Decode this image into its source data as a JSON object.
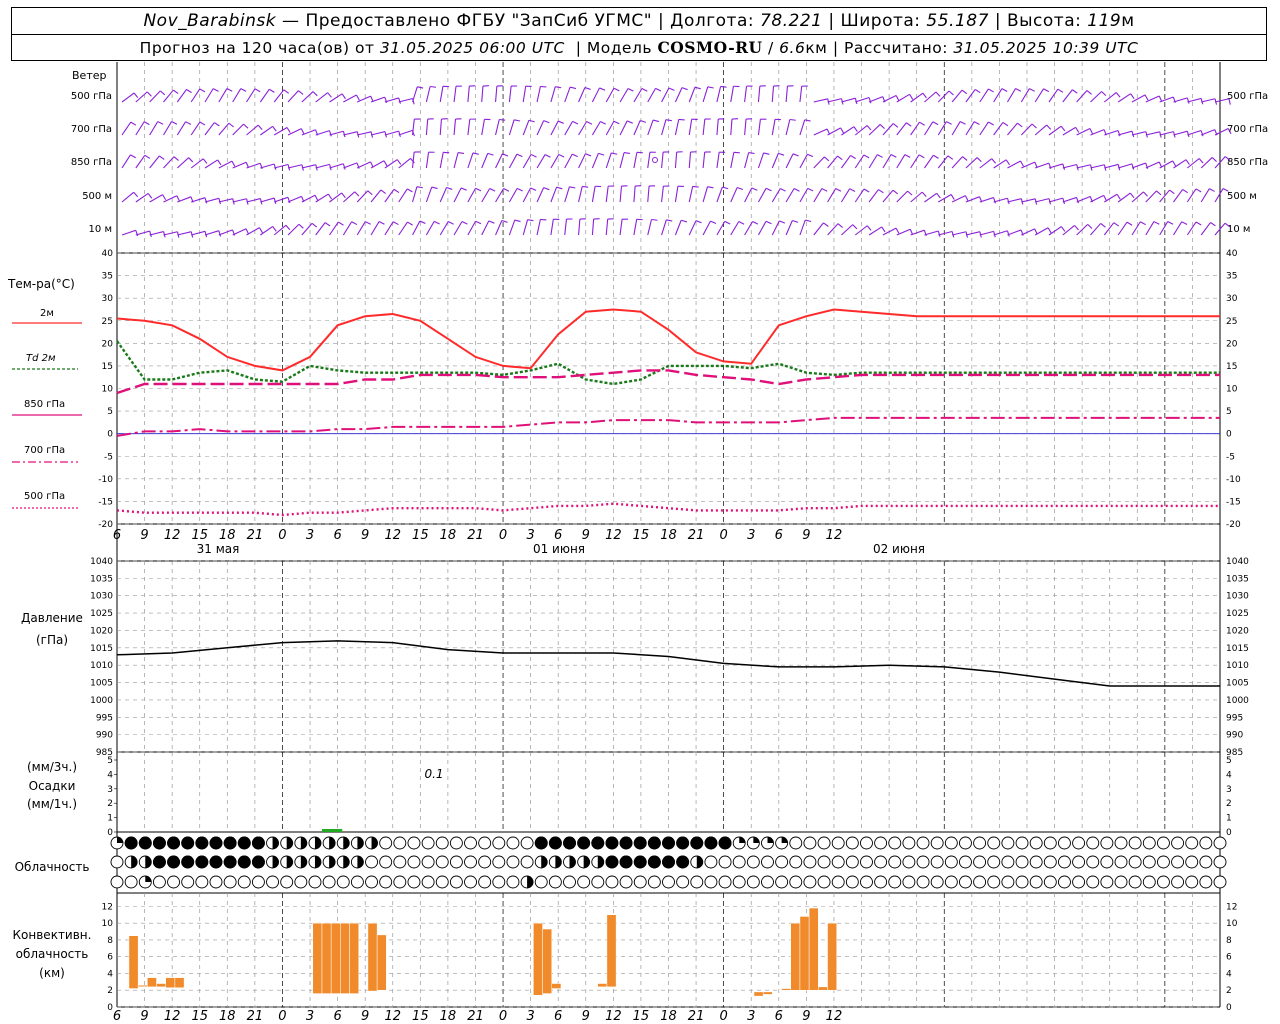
{
  "header": {
    "station": "Nov_Barabinsk",
    "dash": "—",
    "provided_by": "Предоставлено ФГБУ \"ЗапСиб УГМС\"",
    "lon_label": "Долгота:",
    "lon_value": "78.221",
    "lat_label": "Широта:",
    "lat_value": "55.187",
    "alt_label": "Высота:",
    "alt_value": "119",
    "alt_unit": "м",
    "forecast_prefix": "Прогноз на 120 часа(ов) от",
    "forecast_time": "31.05.2025 06:00 UTC",
    "model_label": "Модель",
    "model_name": "COSMO-RU",
    "model_res_value": "6.6",
    "model_res_unit": "км",
    "computed_label": "Рассчитано:",
    "computed_time": "31.05.2025 10:39 UTC"
  },
  "wind_panel": {
    "title": "Ветер",
    "levels": [
      "500 гПа",
      "700 гПа",
      "850 гПа",
      "500 м",
      "10  м"
    ]
  },
  "temp_panel": {
    "title": "Тем-ра(°C)",
    "legend": [
      {
        "label": "2м",
        "color": "#ff2a2a",
        "style": "solid"
      },
      {
        "label": "Td  2м",
        "color": "#1a7a1a",
        "style": "dotted"
      },
      {
        "label": "850 гПа",
        "color": "#e0107a",
        "style": "dashed"
      },
      {
        "label": "700 гПа",
        "color": "#e0107a",
        "style": "dashdot"
      },
      {
        "label": "500 гПа",
        "color": "#e0107a",
        "style": "dotted"
      }
    ],
    "y_ticks": [
      "40",
      "35",
      "30",
      "25",
      "20",
      "15",
      "10",
      "5",
      "0",
      "-5",
      "-10",
      "-15",
      "-20"
    ]
  },
  "time_axis": {
    "hour_labels": [
      "6",
      "9",
      "12",
      "15",
      "18",
      "21",
      "0",
      "3",
      "6",
      "9",
      "12",
      "15",
      "18",
      "21",
      "0",
      "3",
      "6",
      "9",
      "12",
      "15",
      "18",
      "21",
      "0",
      "3",
      "6",
      "9",
      "12"
    ],
    "dates": [
      "31 мая",
      "01 июня",
      "02 июня"
    ]
  },
  "pressure_panel": {
    "title": "Давление",
    "unit": "(гПа)",
    "y_ticks": [
      "1040",
      "1035",
      "1030",
      "1025",
      "1020",
      "1015",
      "1010",
      "1005",
      "1000",
      "995",
      "990",
      "985"
    ]
  },
  "precip_panel": {
    "unit_top": "(мм/3ч.)",
    "title": "Осадки",
    "unit_bottom": "(мм/1ч.)",
    "y_ticks": [
      "5",
      "4",
      "3",
      "2",
      "1",
      "0"
    ],
    "annotation": "0.1"
  },
  "cloud_panel": {
    "title": "Облачность"
  },
  "conv_panel": {
    "title_1": "Конвективн.",
    "title_2": "облачность",
    "unit": "(км)",
    "y_ticks": [
      "12",
      "10",
      "8",
      "6",
      "4",
      "2",
      "0"
    ]
  },
  "chart_data": [
    {
      "type": "line",
      "x_hours": [
        6,
        9,
        12,
        15,
        18,
        21,
        24,
        27,
        30,
        33,
        36,
        39,
        42,
        45,
        48,
        51,
        54,
        57,
        60,
        63,
        66,
        69,
        72,
        75,
        78,
        81,
        84,
        87,
        90,
        93,
        96,
        99,
        102,
        105,
        108,
        111,
        114,
        117,
        120,
        123,
        126
      ],
      "ylim": [
        -20,
        40
      ],
      "series": [
        {
          "name": "2м",
          "values": [
            25.5,
            25,
            24,
            21,
            17,
            15,
            14,
            17,
            24,
            26,
            26.5,
            25,
            21,
            17,
            15,
            14.5,
            22,
            27,
            27.5,
            27,
            23,
            18,
            16,
            15.5,
            24,
            26,
            27.5,
            27,
            26.5,
            26,
            26,
            26,
            26,
            26,
            26,
            26,
            26,
            26,
            26,
            26,
            26
          ]
        },
        {
          "name": "Td  2м",
          "values": [
            20.5,
            12,
            12,
            13.5,
            14,
            12,
            11.5,
            15,
            14,
            13.5,
            13.5,
            13.5,
            13.5,
            13.5,
            13,
            14,
            15.5,
            12,
            11,
            12,
            15,
            15,
            15,
            14.5,
            15.5,
            13.5,
            13,
            13.5,
            13.5,
            13.5,
            13.5,
            13.5,
            13.5,
            13.5,
            13.5,
            13.5,
            13.5,
            13.5,
            13.5,
            13.5,
            13.5
          ]
        },
        {
          "name": "850 гПа",
          "values": [
            9,
            11,
            11,
            11,
            11,
            11,
            11,
            11,
            11,
            12,
            12,
            13,
            13,
            13,
            12.5,
            12.5,
            12.5,
            13,
            13.5,
            14,
            14,
            13,
            12.5,
            12,
            11,
            12,
            12.5,
            13,
            13,
            13,
            13,
            13,
            13,
            13,
            13,
            13,
            13,
            13,
            13,
            13,
            13
          ]
        },
        {
          "name": "700 гПа",
          "values": [
            -0.5,
            0.5,
            0.5,
            1,
            0.5,
            0.5,
            0.5,
            0.5,
            1,
            1,
            1.5,
            1.5,
            1.5,
            1.5,
            1.5,
            2,
            2.5,
            2.5,
            3,
            3,
            3,
            2.5,
            2.5,
            2.5,
            2.5,
            3,
            3.5,
            3.5,
            3.5,
            3.5,
            3.5,
            3.5,
            3.5,
            3.5,
            3.5,
            3.5,
            3.5,
            3.5,
            3.5,
            3.5,
            3.5
          ]
        },
        {
          "name": "500 гПа",
          "values": [
            -17,
            -17.5,
            -17.5,
            -17.5,
            -17.5,
            -17.5,
            -18,
            -17.5,
            -17.5,
            -17,
            -16.5,
            -16.5,
            -16.5,
            -16.5,
            -17,
            -16.5,
            -16,
            -16,
            -15.5,
            -16,
            -16.5,
            -17,
            -17,
            -17,
            -17,
            -16.5,
            -16.5,
            -16,
            -16,
            -16,
            -16,
            -16,
            -16,
            -16,
            -16,
            -16,
            -16,
            -16,
            -16,
            -16,
            -16
          ]
        }
      ]
    },
    {
      "type": "line",
      "x_hours": [
        6,
        12,
        18,
        24,
        30,
        36,
        42,
        48,
        54,
        60,
        66,
        72,
        78,
        84,
        90,
        96,
        102,
        108,
        114,
        120,
        126
      ],
      "ylim": [
        985,
        1040
      ],
      "series": [
        {
          "name": "Давление",
          "values": [
            1013,
            1013.5,
            1015,
            1016.5,
            1017,
            1016.5,
            1014.5,
            1013.5,
            1013.5,
            1013.5,
            1012.5,
            1010.5,
            1009.5,
            1009.5,
            1010,
            1009.5,
            1008,
            1006,
            1004,
            1004,
            1004
          ]
        }
      ]
    },
    {
      "type": "bar",
      "x_hours": [
        4,
        5
      ],
      "ylim": [
        0,
        5
      ],
      "series": [
        {
          "name": "Осадки",
          "values": [
            0.1,
            0.1
          ]
        }
      ]
    },
    {
      "type": "bar",
      "ylim": [
        0,
        12
      ],
      "bars": [
        {
          "x0": 7.3,
          "x1": 8.3,
          "base": 2.2,
          "top": 8.5
        },
        {
          "x0": 8.3,
          "x1": 9.3,
          "base": 2.6,
          "top": 2.6
        },
        {
          "x0": 9.3,
          "x1": 10.3,
          "base": 2.4,
          "top": 3.5
        },
        {
          "x0": 10.3,
          "x1": 11.3,
          "base": 2.4,
          "top": 2.8
        },
        {
          "x0": 11.3,
          "x1": 12.3,
          "base": 2.3,
          "top": 3.5
        },
        {
          "x0": 12.3,
          "x1": 13.3,
          "base": 2.3,
          "top": 3.5
        },
        {
          "x0": 27.3,
          "x1": 28.3,
          "base": 1.6,
          "top": 10
        },
        {
          "x0": 28.3,
          "x1": 29.3,
          "base": 1.6,
          "top": 10
        },
        {
          "x0": 29.3,
          "x1": 30.3,
          "base": 1.6,
          "top": 10
        },
        {
          "x0": 30.3,
          "x1": 31.3,
          "base": 1.6,
          "top": 10
        },
        {
          "x0": 31.3,
          "x1": 32.3,
          "base": 1.6,
          "top": 10
        },
        {
          "x0": 33.3,
          "x1": 34.3,
          "base": 1.9,
          "top": 10
        },
        {
          "x0": 34.3,
          "x1": 35.3,
          "base": 2,
          "top": 8.6
        },
        {
          "x0": 51.3,
          "x1": 52.3,
          "base": 1.4,
          "top": 10
        },
        {
          "x0": 52.3,
          "x1": 53.3,
          "base": 1.6,
          "top": 9.3
        },
        {
          "x0": 53.3,
          "x1": 54.3,
          "base": 2.2,
          "top": 2.8
        },
        {
          "x0": 58.3,
          "x1": 59.3,
          "base": 2.4,
          "top": 2.8
        },
        {
          "x0": 59.3,
          "x1": 60.3,
          "base": 2.4,
          "top": 11
        },
        {
          "x0": 75.3,
          "x1": 76.3,
          "base": 1.3,
          "top": 1.8
        },
        {
          "x0": 76.3,
          "x1": 77.3,
          "base": 1.5,
          "top": 1.8
        },
        {
          "x0": 78.3,
          "x1": 79.3,
          "base": 2,
          "top": 2.2
        },
        {
          "x0": 79.3,
          "x1": 80.3,
          "base": 2,
          "top": 10
        },
        {
          "x0": 80.3,
          "x1": 81.3,
          "base": 2,
          "top": 10.8
        },
        {
          "x0": 81.3,
          "x1": 82.3,
          "base": 2,
          "top": 11.8
        },
        {
          "x0": 82.3,
          "x1": 83.3,
          "base": 2,
          "top": 2.4
        },
        {
          "x0": 83.3,
          "x1": 84.3,
          "base": 2,
          "top": 10
        }
      ]
    }
  ],
  "colors": {
    "wind": "#8a20d8",
    "temp2m": "#ff2a2a",
    "dew": "#1a7a1a",
    "upper": "#e0107a",
    "zero_line": "#2020d0",
    "pressure": "#000000",
    "precip": "#22aa22",
    "conv": "#f08a2a",
    "grid": "#999999"
  }
}
